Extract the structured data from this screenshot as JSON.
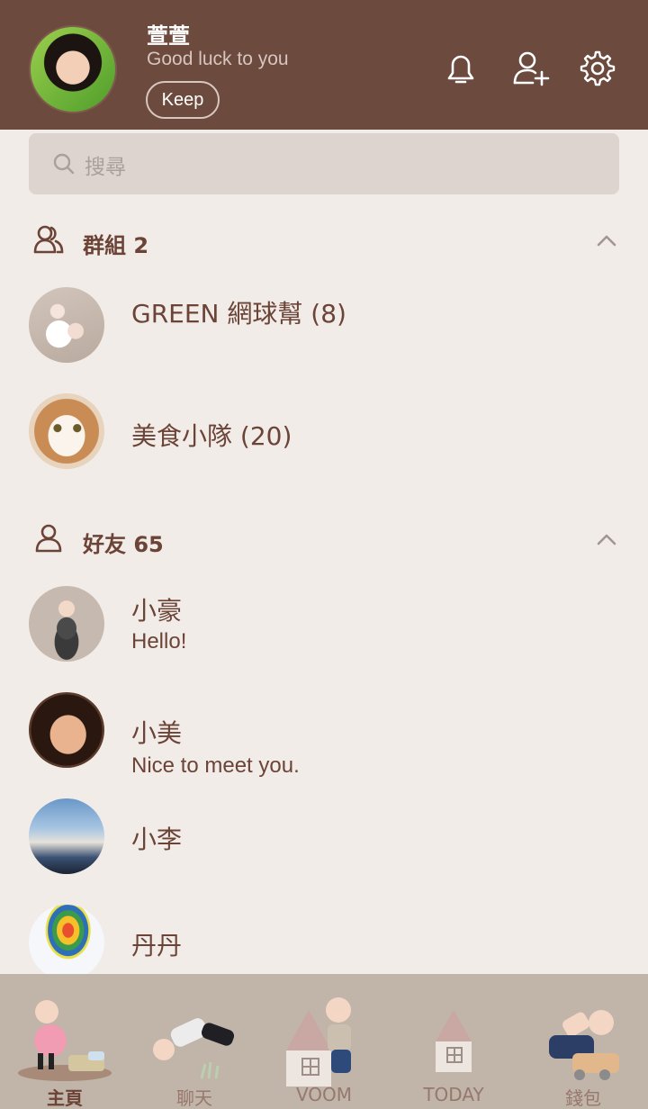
{
  "profile": {
    "name": "萱萱",
    "status": "Good luck to you",
    "keep_label": "Keep"
  },
  "header_icons": [
    "bell-icon",
    "add-friend-icon",
    "gear-icon"
  ],
  "search": {
    "placeholder": "搜尋"
  },
  "groups": {
    "title": "群組 2",
    "items": [
      {
        "name": "GREEN 網球幫 (8)"
      },
      {
        "name": "美食小隊 (20)"
      }
    ]
  },
  "friends": {
    "title": "好友 65",
    "items": [
      {
        "name": "小豪",
        "message": "Hello!"
      },
      {
        "name": "小美",
        "message": "Nice to meet you."
      },
      {
        "name": "小李",
        "message": ""
      },
      {
        "name": "丹丹",
        "message": ""
      }
    ]
  },
  "tabs": [
    {
      "label": "主頁",
      "active": true
    },
    {
      "label": "聊天",
      "active": false
    },
    {
      "label": "VOOM",
      "active": false
    },
    {
      "label": "TODAY",
      "active": false
    },
    {
      "label": "錢包",
      "active": false
    }
  ],
  "colors": {
    "header": "#6d4a3e",
    "background": "#f1ece7",
    "text": "#6b4337",
    "tabbar": "#c1b4a9"
  }
}
